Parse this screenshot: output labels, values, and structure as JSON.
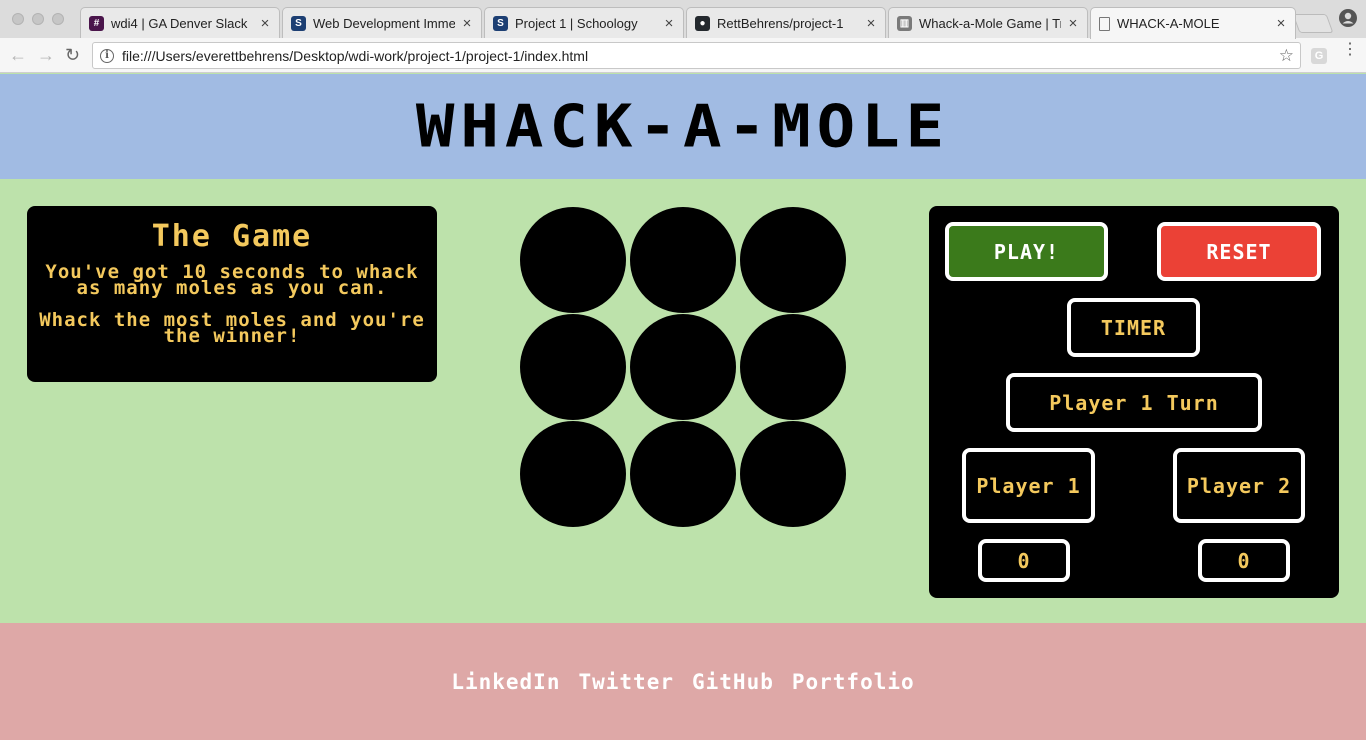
{
  "browser": {
    "tabs": [
      {
        "title": "wdi4 | GA Denver Slack",
        "favicon": "slack-hash-icon",
        "favicon_char": "#",
        "favicon_color": "#4a154b"
      },
      {
        "title": "Web Development Immersive",
        "favicon": "schoology-icon",
        "favicon_char": "S",
        "favicon_color": "#1d3f73"
      },
      {
        "title": "Project 1 | Schoology",
        "favicon": "schoology-icon",
        "favicon_char": "S",
        "favicon_color": "#1d3f73"
      },
      {
        "title": "RettBehrens/project-1",
        "favicon": "github-icon",
        "favicon_char": "●",
        "favicon_color": "#24292e"
      },
      {
        "title": "Whack-a-Mole Game | Trello",
        "favicon": "trello-icon",
        "favicon_char": "▥",
        "favicon_color": "#7a7a7a"
      },
      {
        "title": "WHACK-A-MOLE",
        "favicon": "document-icon",
        "favicon_char": "",
        "favicon_color": "#ffffff"
      }
    ],
    "close_glyph": "×",
    "back_glyph": "←",
    "forward_glyph": "→",
    "reload_glyph": "↻",
    "info_glyph": "i",
    "url": "file:///Users/everettbehrens/Desktop/wdi-work/project-1/project-1/index.html",
    "star_glyph": "☆",
    "ext_glyph": "G",
    "menu_glyph": "⋮"
  },
  "header": {
    "title": "WHACK-A-MOLE"
  },
  "info": {
    "title": "The Game",
    "line1": "You've got 10 seconds to whack as many moles as you can.",
    "line2": "Whack the most moles and you're the winner!"
  },
  "board": {
    "holes": 9
  },
  "controls": {
    "play_label": "PLAY!",
    "reset_label": "RESET",
    "timer_label": "TIMER",
    "turn_label": "Player 1 Turn",
    "player1_label": "Player 1",
    "player2_label": "Player 2",
    "player1_score": "0",
    "player2_score": "0"
  },
  "footer": {
    "links": [
      "LinkedIn",
      "Twitter",
      "GitHub",
      "Portfolio"
    ]
  },
  "colors": {
    "header_bg": "#a1bbe3",
    "main_bg": "#bde2ab",
    "footer_bg": "#dea8a7",
    "accent_text": "#f4c95d",
    "play_green": "#3b7a1b",
    "reset_red": "#eb4136"
  }
}
